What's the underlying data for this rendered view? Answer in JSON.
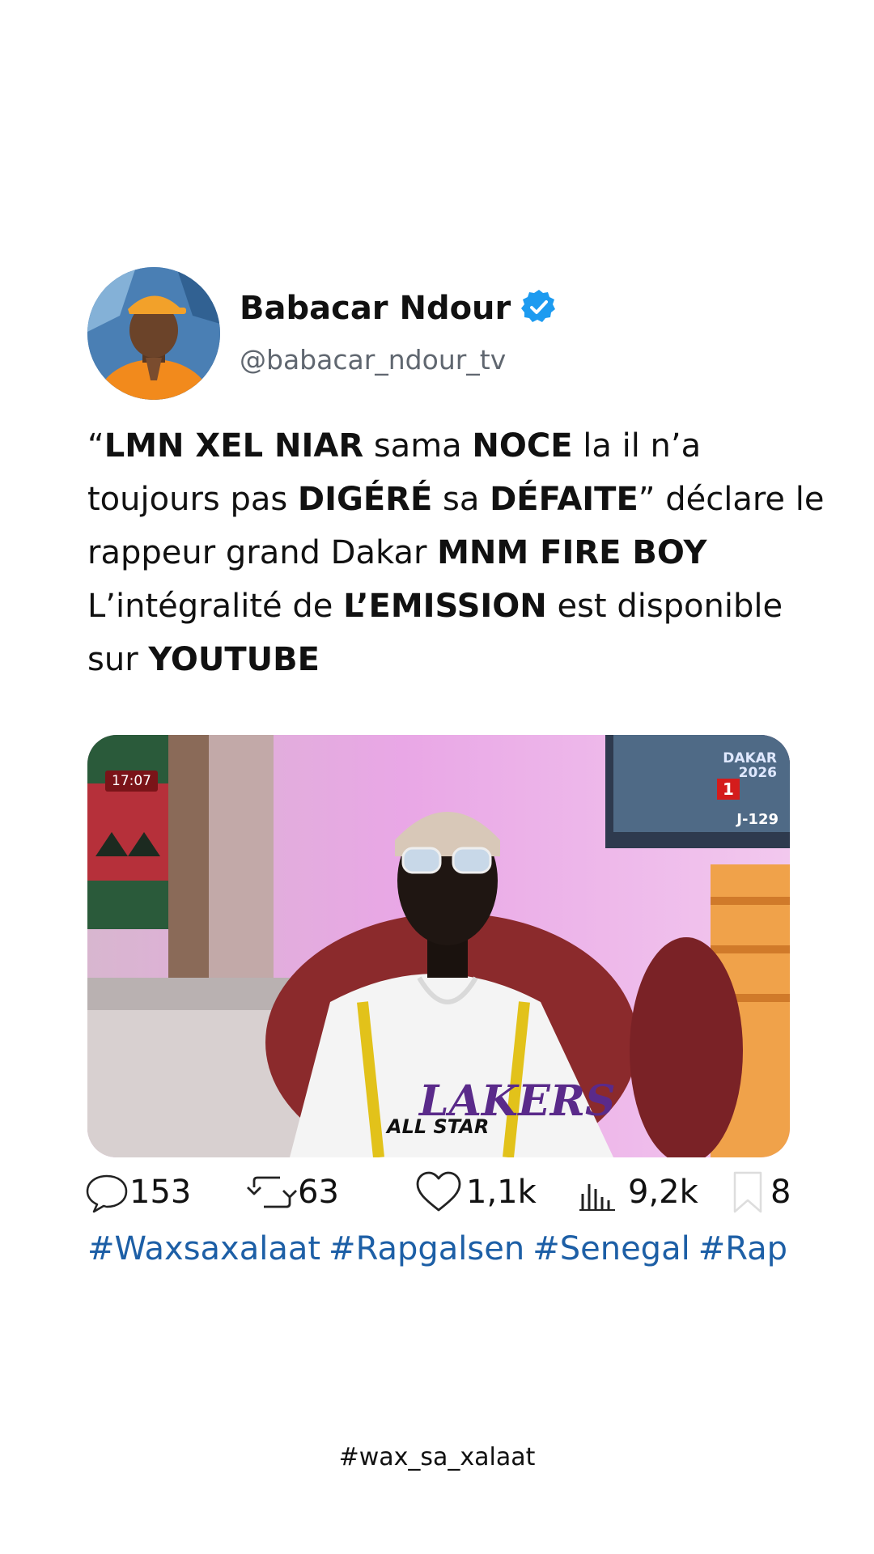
{
  "author": {
    "name": "Babacar Ndour",
    "handle": "@babacar_ndour_tv",
    "verified": true,
    "verified_color": "#1d9bf0"
  },
  "post": {
    "segments": [
      {
        "text": "“",
        "bold": false
      },
      {
        "text": "LMN XEL NIAR",
        "bold": true
      },
      {
        "text": " sama ",
        "bold": false
      },
      {
        "text": "NOCE",
        "bold": true
      },
      {
        "text": " la il n’a toujours pas ",
        "bold": false
      },
      {
        "text": "DIGÉRÉ",
        "bold": true
      },
      {
        "text": " sa ",
        "bold": false
      },
      {
        "text": "DÉFAITE",
        "bold": true
      },
      {
        "text": "” déclare le rappeur grand Dakar ",
        "bold": false
      },
      {
        "text": "MNM FIRE BOY",
        "bold": true
      },
      {
        "text": "\nL’intégralité de ",
        "bold": false
      },
      {
        "text": "L’EMISSION",
        "bold": true
      },
      {
        "text": " est disponible sur ",
        "bold": false
      },
      {
        "text": "YOUTUBE",
        "bold": true
      }
    ]
  },
  "media": {
    "timestamp": "17:07",
    "channel_number": "1",
    "event_badge_line1": "DAKAR",
    "event_badge_line2": "2026",
    "countdown": "J-129",
    "jersey_text": "ALL STAR"
  },
  "stats": {
    "replies": "153",
    "reposts": "63",
    "likes": "1,1k",
    "views": "9,2k",
    "bookmarks": "8"
  },
  "hashtags": [
    "#Waxsaxalaat",
    "#Rapgalsen",
    "#Senegal",
    "#Rap"
  ],
  "footer": {
    "tag": "#wax_sa_xalaat"
  },
  "colors": {
    "hashtag": "#1d5fa6",
    "handle": "#606770",
    "text": "#111111"
  }
}
